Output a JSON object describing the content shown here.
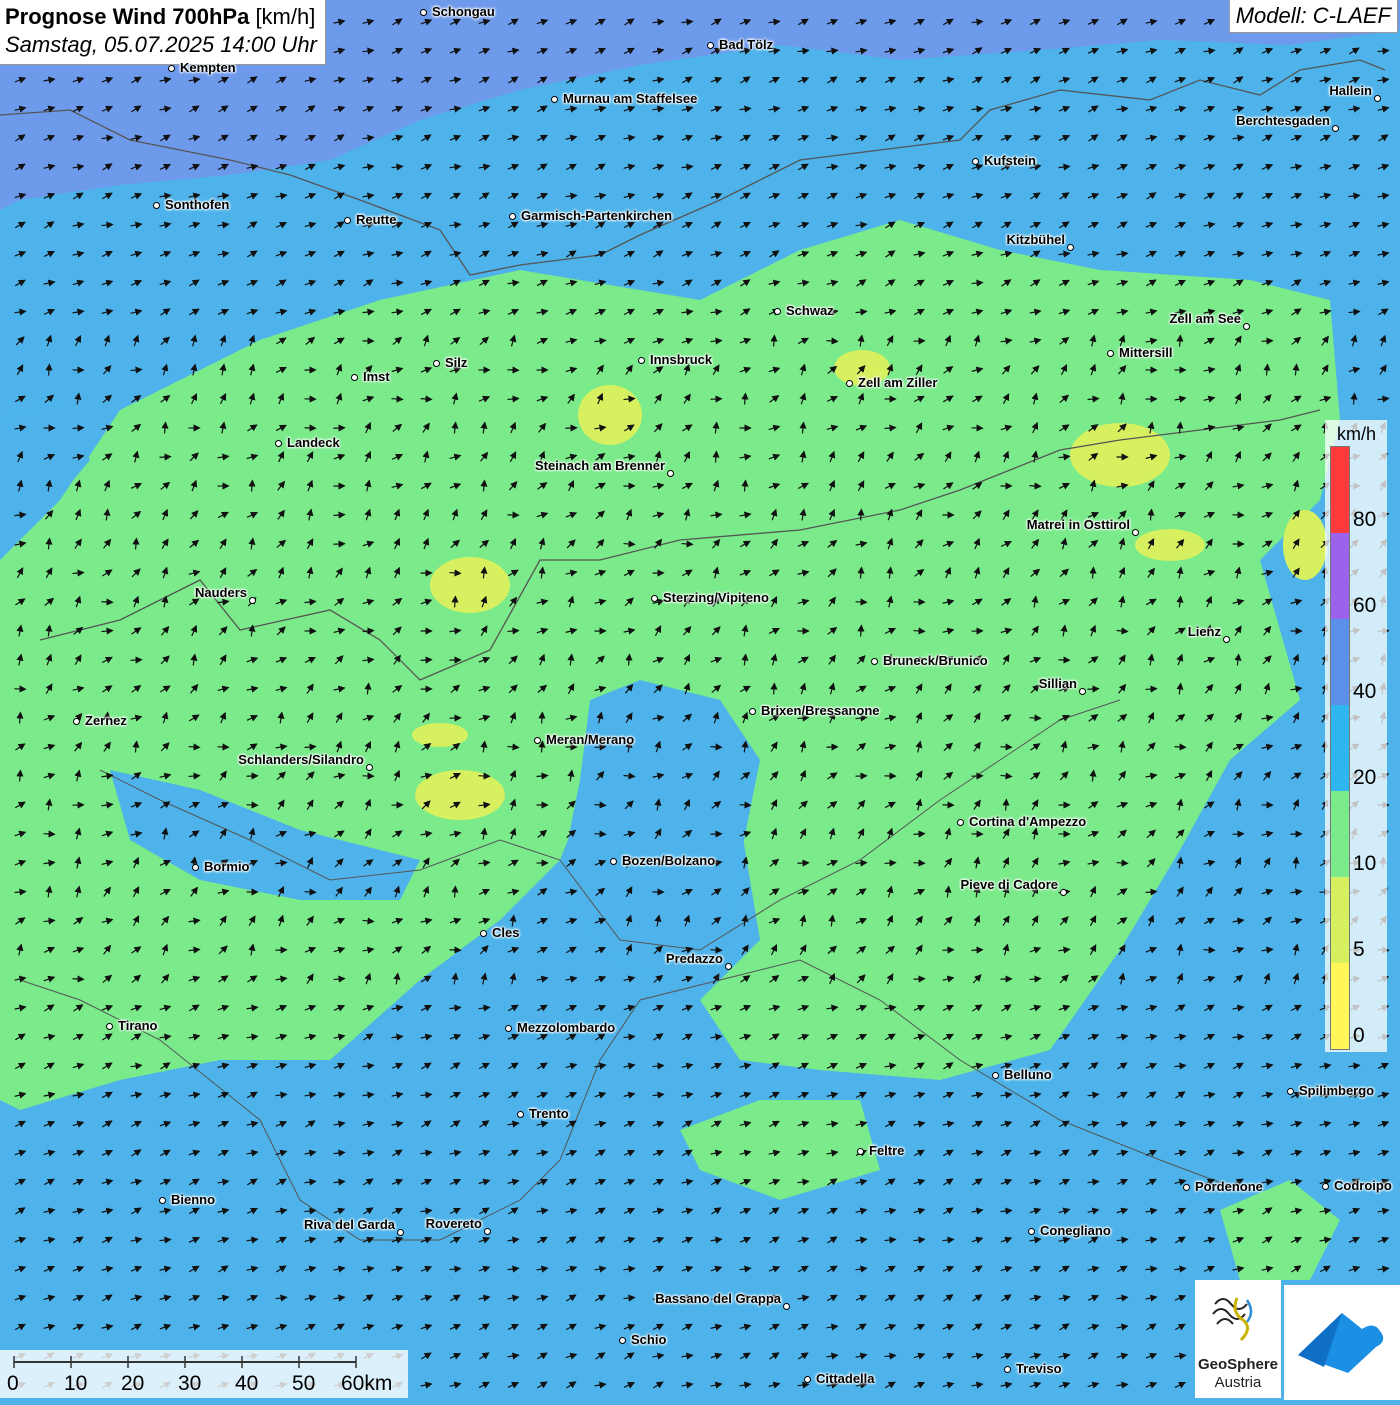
{
  "header": {
    "title_bold": "Prognose Wind 700hPa",
    "title_unit": "[km/h]",
    "datetime": "Samstag, 05.07.2025 14:00 Uhr",
    "model": "Modell: C-LAEF"
  },
  "legend": {
    "unit": "km/h",
    "labels": [
      "80",
      "60",
      "40",
      "20",
      "10",
      "5",
      "0"
    ],
    "colors": [
      "#ff3a3a",
      "#9b63ec",
      "#5b8fe8",
      "#2fb6ee",
      "#7aea8a",
      "#d6f060",
      "#fff65a"
    ]
  },
  "scale_bar": {
    "labels": [
      "0",
      "10",
      "20",
      "30",
      "40",
      "50",
      "60km"
    ]
  },
  "logo": {
    "name_line1": "GeoSphere",
    "name_line2": "Austria"
  },
  "cities": [
    {
      "name": "Schongau",
      "label_side": "right"
    },
    {
      "name": "Bad Tölz",
      "label_side": "right"
    },
    {
      "name": "Kempten",
      "label_side": "right"
    },
    {
      "name": "Murnau am Staffelsee",
      "label_side": "right"
    },
    {
      "name": "Hallein",
      "label_side": "left"
    },
    {
      "name": "Berchtesgaden",
      "label_side": "left"
    },
    {
      "name": "Kufstein",
      "label_side": "right"
    },
    {
      "name": "Sonthofen",
      "label_side": "right"
    },
    {
      "name": "Reutte",
      "label_side": "right"
    },
    {
      "name": "Garmisch-Partenkirchen",
      "label_side": "right"
    },
    {
      "name": "Kitzbühel",
      "label_side": "left"
    },
    {
      "name": "Schwaz",
      "label_side": "right"
    },
    {
      "name": "Zell am See",
      "label_side": "left"
    },
    {
      "name": "Innsbruck",
      "label_side": "right"
    },
    {
      "name": "Mittersill",
      "label_side": "right"
    },
    {
      "name": "Silz",
      "label_side": "right"
    },
    {
      "name": "Imst",
      "label_side": "right"
    },
    {
      "name": "Zell am Ziller",
      "label_side": "right"
    },
    {
      "name": "Landeck",
      "label_side": "right"
    },
    {
      "name": "Steinach am Brenner",
      "label_side": "left"
    },
    {
      "name": "Matrei in Osttirol",
      "label_side": "left"
    },
    {
      "name": "Nauders",
      "label_side": "left"
    },
    {
      "name": "Sterzing/Vipiteno",
      "label_side": "right"
    },
    {
      "name": "Lienz",
      "label_side": "left"
    },
    {
      "name": "Bruneck/Brunico",
      "label_side": "right"
    },
    {
      "name": "Sillian",
      "label_side": "left"
    },
    {
      "name": "Brixen/Bressanone",
      "label_side": "right"
    },
    {
      "name": "Zernez",
      "label_side": "right"
    },
    {
      "name": "Meran/Merano",
      "label_side": "right"
    },
    {
      "name": "Schlanders/Silandro",
      "label_side": "left"
    },
    {
      "name": "Cortina d'Ampezzo",
      "label_side": "right"
    },
    {
      "name": "Bozen/Bolzano",
      "label_side": "right"
    },
    {
      "name": "Bormio",
      "label_side": "right"
    },
    {
      "name": "Pieve di Cadore",
      "label_side": "left"
    },
    {
      "name": "Cles",
      "label_side": "right"
    },
    {
      "name": "Predazzo",
      "label_side": "left"
    },
    {
      "name": "Tirano",
      "label_side": "right"
    },
    {
      "name": "Mezzolombardo",
      "label_side": "right"
    },
    {
      "name": "Belluno",
      "label_side": "right"
    },
    {
      "name": "Spilimbergo",
      "label_side": "right"
    },
    {
      "name": "Trento",
      "label_side": "right"
    },
    {
      "name": "Feltre",
      "label_side": "right"
    },
    {
      "name": "Pordenone",
      "label_side": "right"
    },
    {
      "name": "Codroipo",
      "label_side": "right"
    },
    {
      "name": "Bienno",
      "label_side": "right"
    },
    {
      "name": "Riva del Garda",
      "label_side": "left"
    },
    {
      "name": "Rovereto",
      "label_side": "left"
    },
    {
      "name": "Conegliano",
      "label_side": "right"
    },
    {
      "name": "Bassano del Grappa",
      "label_side": "left"
    },
    {
      "name": "Schio",
      "label_side": "right"
    },
    {
      "name": "Treviso",
      "label_side": "right"
    },
    {
      "name": "Cittadella",
      "label_side": "right"
    }
  ]
}
